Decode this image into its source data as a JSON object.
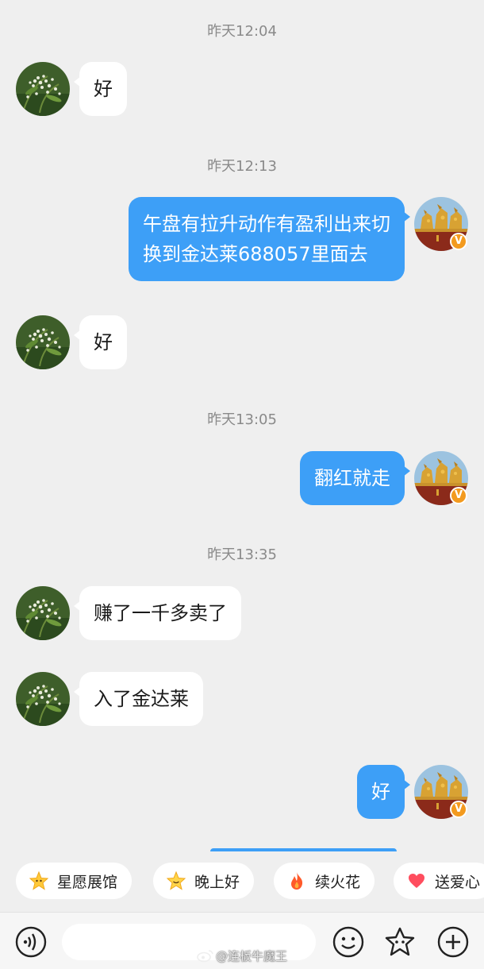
{
  "messages": [
    {
      "type": "time",
      "text": "昨天12:04"
    },
    {
      "type": "in",
      "text": "好"
    },
    {
      "type": "time",
      "text": "昨天12:13"
    },
    {
      "type": "out",
      "lines": [
        "午盘有拉升动作有盈利出来切",
        "换到金达莱688057里面去"
      ]
    },
    {
      "type": "in",
      "text": "好"
    },
    {
      "type": "time",
      "text": "昨天13:05"
    },
    {
      "type": "out",
      "text": "翻红就走"
    },
    {
      "type": "time",
      "text": "昨天13:35"
    },
    {
      "type": "in",
      "text": "赚了一千多卖了"
    },
    {
      "type": "in",
      "text": "入了金达莱"
    },
    {
      "type": "out",
      "text": "好"
    }
  ],
  "verified_badge": "V",
  "quick_replies": [
    {
      "icon": "star-face-icon",
      "label": "星愿展馆"
    },
    {
      "icon": "smiling-star-icon",
      "label": "晚上好"
    },
    {
      "icon": "fire-icon",
      "label": "续火花"
    },
    {
      "icon": "heart-icon",
      "label": "送爱心"
    }
  ],
  "input_bar": {
    "voice_icon": "voice-icon",
    "emoji_icon": "emoji-icon",
    "sticker_icon": "sticker-star-icon",
    "plus_icon": "plus-icon",
    "placeholder": ""
  },
  "watermark": {
    "text": "@连板牛魔王"
  },
  "colors": {
    "background": "#efefef",
    "outgoing_bubble": "#3d9ff7",
    "incoming_bubble": "#ffffff",
    "timestamp": "#8a8a8a",
    "badge": "#f39a1e"
  }
}
